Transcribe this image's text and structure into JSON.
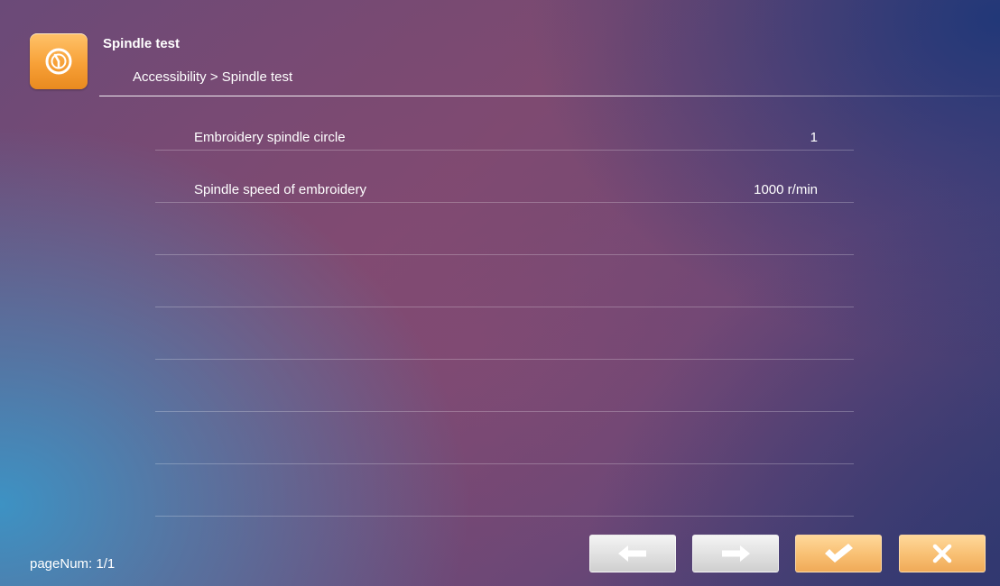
{
  "header": {
    "title": "Spindle test",
    "breadcrumb": "Accessibility > Spindle test",
    "icon": "gauge-icon",
    "icon_color": "#f7a037"
  },
  "params": {
    "rows": [
      {
        "name": "Embroidery spindle circle",
        "value": "1"
      },
      {
        "name": "Spindle speed of embroidery",
        "value": "1000 r/min"
      },
      {
        "name": "",
        "value": ""
      },
      {
        "name": "",
        "value": ""
      },
      {
        "name": "",
        "value": ""
      },
      {
        "name": "",
        "value": ""
      },
      {
        "name": "",
        "value": ""
      },
      {
        "name": "",
        "value": ""
      }
    ]
  },
  "footer": {
    "page_num": "pageNum: 1/1",
    "buttons": [
      {
        "name": "prev-page-button",
        "icon": "arrow-left-icon",
        "color": "#dedede"
      },
      {
        "name": "next-page-button",
        "icon": "arrow-right-icon",
        "color": "#dedede"
      },
      {
        "name": "confirm-button",
        "icon": "checkmark-icon",
        "color": "#f8bf72"
      },
      {
        "name": "close-button",
        "icon": "close-icon",
        "color": "#f8bf72"
      }
    ]
  }
}
